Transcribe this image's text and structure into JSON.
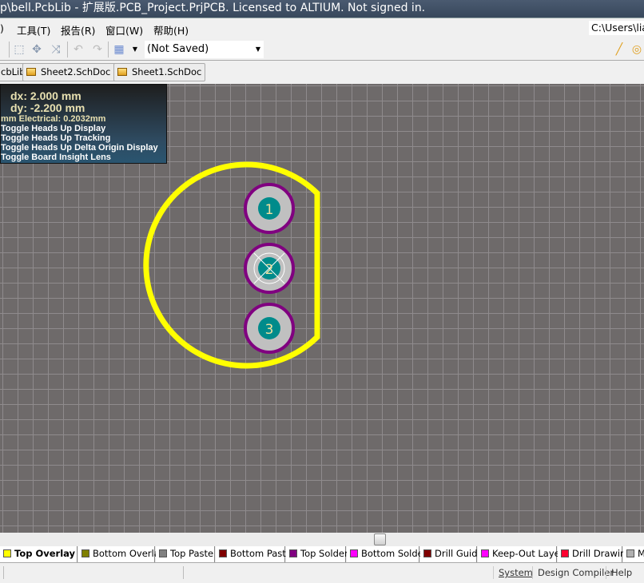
{
  "title": "p\\bell.PcbLib - 扩展版.PCB_Project.PrjPCB. Licensed to ALTIUM. Not signed in.",
  "menu": [
    {
      "label": ")"
    },
    {
      "label": "工具(T)"
    },
    {
      "label": "报告(R)"
    },
    {
      "label": "窗口(W)"
    },
    {
      "label": "帮助(H)"
    }
  ],
  "path_box": "C:\\Users\\lia",
  "toolbar": {
    "view_select": "(Not Saved)",
    "icons": [
      "select-rect-icon",
      "move-icon",
      "cross-select-icon",
      "undo-icon",
      "redo-icon",
      "grid-icon",
      "line-icon",
      "pad-icon"
    ]
  },
  "doc_tabs": [
    {
      "label": "cbLib"
    },
    {
      "label": "Sheet2.SchDoc *"
    },
    {
      "label": "Sheet1.SchDoc"
    }
  ],
  "hud": {
    "dx": "dx:  2.000  mm",
    "dy": "dy: -2.200  mm",
    "electrical": "mm Electrical: 0.2032mm",
    "lines": [
      "Toggle Heads Up Display",
      "Toggle Heads Up Tracking",
      "Toggle Heads Up Delta Origin Display",
      "Toggle Board Insight Lens"
    ]
  },
  "pads": [
    {
      "label": "1"
    },
    {
      "label": "2"
    },
    {
      "label": "3"
    }
  ],
  "colors": {
    "overlay": "#ffff00",
    "pad": "#c0c0c0",
    "solder": "#800080",
    "hole": "#008b8b",
    "canvas": "#6e6a6a"
  },
  "layer_tabs": [
    {
      "label": "Top Overlay",
      "color": "#ffff00",
      "active": true
    },
    {
      "label": "Bottom Overlay",
      "color": "#808000"
    },
    {
      "label": "Top Paste",
      "color": "#808080"
    },
    {
      "label": "Bottom Paste",
      "color": "#800000"
    },
    {
      "label": "Top Solder",
      "color": "#800080"
    },
    {
      "label": "Bottom Solder",
      "color": "#ff00ff"
    },
    {
      "label": "Drill Guide",
      "color": "#800000"
    },
    {
      "label": "Keep-Out Layer",
      "color": "#ff00ff"
    },
    {
      "label": "Drill Drawing",
      "color": "#ff0030"
    },
    {
      "label": "M",
      "color": "#b0b0b0"
    }
  ],
  "status": [
    {
      "label": "System"
    },
    {
      "label": "Design Compiler"
    },
    {
      "label": "Help"
    }
  ]
}
